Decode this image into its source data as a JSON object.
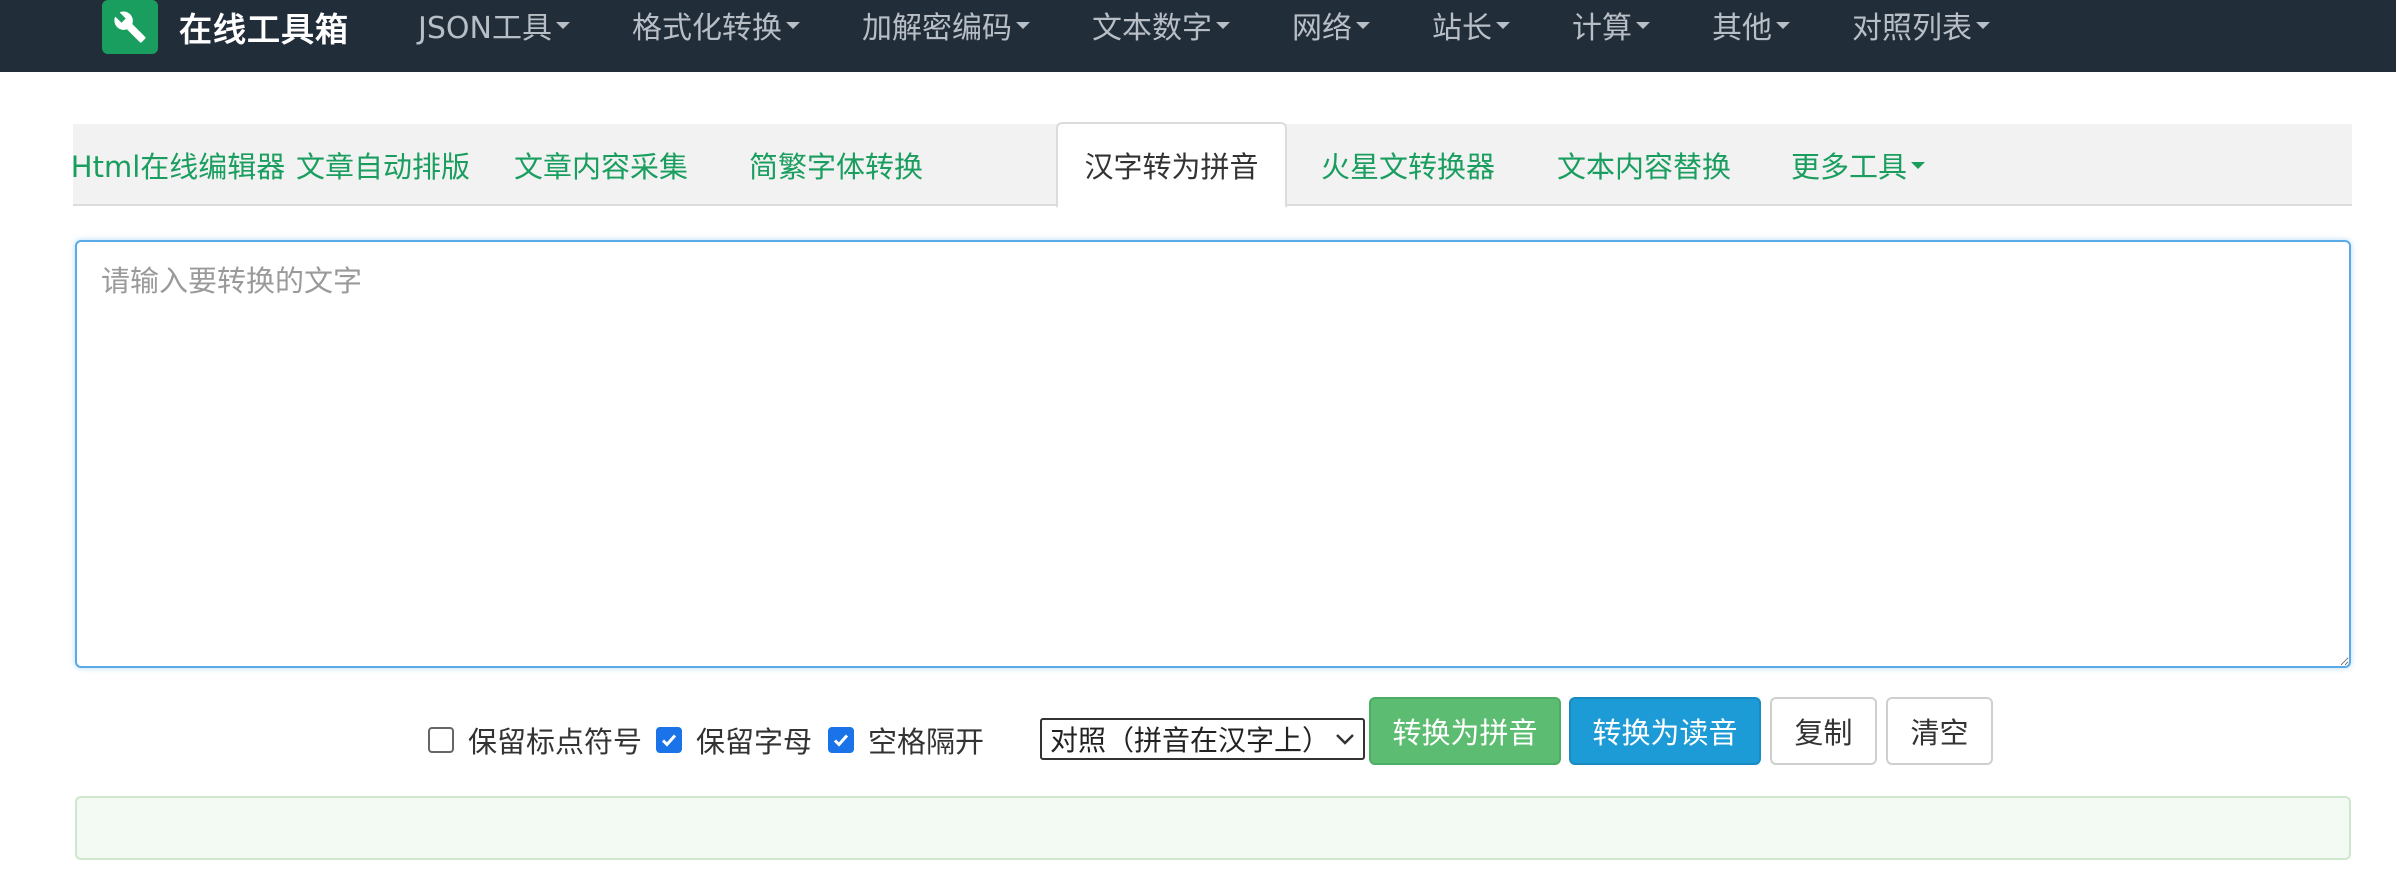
{
  "brand": {
    "title": "在线工具箱",
    "icon": "wrench-icon"
  },
  "nav": {
    "items": [
      {
        "label": "JSON工具"
      },
      {
        "label": "格式化转换"
      },
      {
        "label": "加解密编码"
      },
      {
        "label": "文本数字"
      },
      {
        "label": "网络"
      },
      {
        "label": "站长"
      },
      {
        "label": "计算"
      },
      {
        "label": "其他"
      },
      {
        "label": "对照列表"
      }
    ]
  },
  "tabs": [
    {
      "label": "Html在线编辑器"
    },
    {
      "label": "文章自动排版"
    },
    {
      "label": "文章内容采集"
    },
    {
      "label": "简繁字体转换"
    },
    {
      "label": "汉字转为拼音",
      "active": true
    },
    {
      "label": "火星文转换器"
    },
    {
      "label": "文本内容替换"
    },
    {
      "label": "更多工具"
    }
  ],
  "editor": {
    "placeholder": "请输入要转换的文字",
    "value": ""
  },
  "options": {
    "keep_punctuation": {
      "label": "保留标点符号",
      "checked": false
    },
    "keep_letters": {
      "label": "保留字母",
      "checked": true
    },
    "space_separate": {
      "label": "空格隔开",
      "checked": true
    },
    "mode_select": {
      "selected": "对照（拼音在汉字上）"
    }
  },
  "buttons": {
    "to_pinyin": "转换为拼音",
    "to_reading": "转换为读音",
    "copy": "复制",
    "clear": "清空"
  },
  "result": {
    "text": ""
  },
  "colors": {
    "navbar_bg": "#222d3a",
    "brand_green": "#1a9e5f",
    "btn_green": "#5cbd72",
    "btn_blue": "#1d9bd6",
    "checkbox_blue": "#1a73e8"
  }
}
